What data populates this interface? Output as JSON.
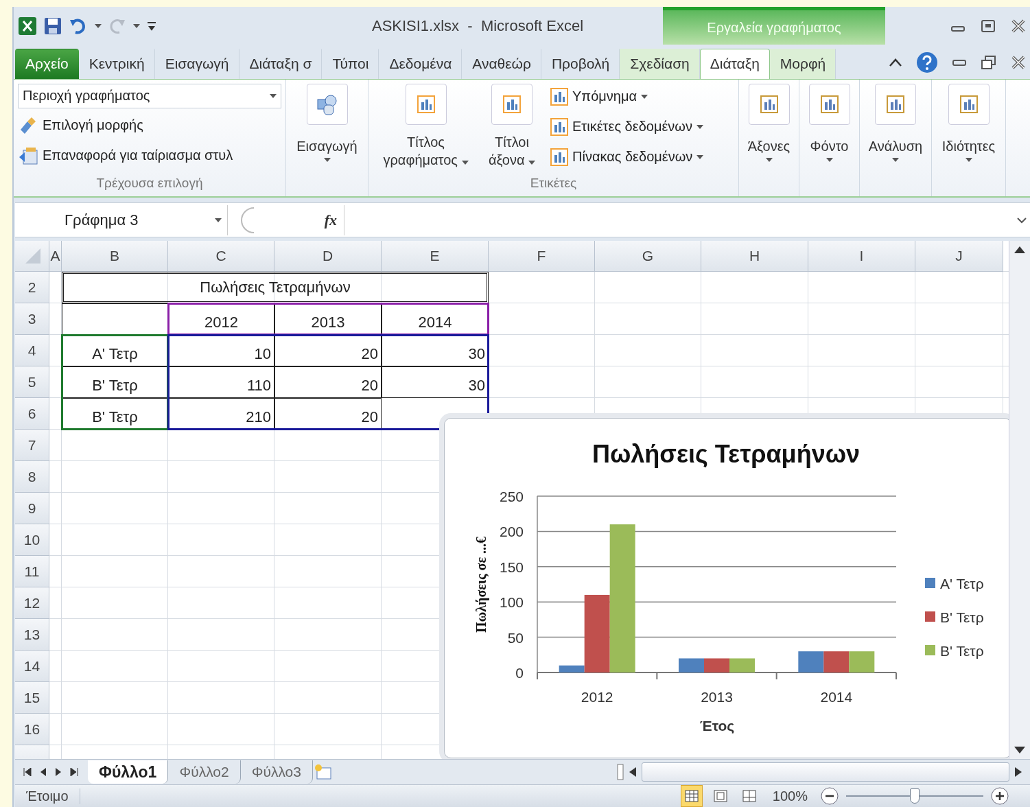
{
  "window": {
    "title": "ASKISI1.xlsx  -  Microsoft Excel",
    "context_title": "Εργαλεία γραφήματος"
  },
  "ribbon_tabs": [
    {
      "label": "Αρχείο",
      "kind": "file",
      "selected": false
    },
    {
      "label": "Κεντρική",
      "kind": "tab",
      "selected": false
    },
    {
      "label": "Εισαγωγή",
      "kind": "tab",
      "selected": false
    },
    {
      "label": "Διάταξη σ",
      "kind": "tab",
      "selected": false
    },
    {
      "label": "Τύποι",
      "kind": "tab",
      "selected": false
    },
    {
      "label": "Δεδομένα",
      "kind": "tab",
      "selected": false
    },
    {
      "label": "Αναθεώρ",
      "kind": "tab",
      "selected": false
    },
    {
      "label": "Προβολή",
      "kind": "tab",
      "selected": false
    },
    {
      "label": "Σχεδίαση",
      "kind": "context",
      "selected": false
    },
    {
      "label": "Διάταξη",
      "kind": "context",
      "selected": true
    },
    {
      "label": "Μορφή",
      "kind": "context",
      "selected": false
    }
  ],
  "ribbon": {
    "current_selection": {
      "dropdown": "Περιοχή γραφήματος",
      "buttons": [
        "Επιλογή μορφής",
        "Επαναφορά για ταίριασμα στυλ"
      ],
      "label": "Τρέχουσα επιλογή"
    },
    "insert": {
      "button": "Εισαγωγή"
    },
    "labels": {
      "large_buttons": [
        "Τίτλος γραφήματος",
        "Τίτλοι άξονα"
      ],
      "small_buttons": [
        "Υπόμνημα",
        "Ετικέτες δεδομένων",
        "Πίνακας δεδομένων"
      ],
      "label": "Ετικέτες"
    },
    "tool_buttons": [
      "Άξονες",
      "Φόντο",
      "Ανάλυση",
      "Ιδιότητες"
    ]
  },
  "formula_bar": {
    "name_box": "Γράφημα 3",
    "fx_label": "fx"
  },
  "sheet": {
    "columns": [
      "A",
      "B",
      "C",
      "D",
      "E",
      "F",
      "G",
      "H",
      "I",
      "J"
    ],
    "row_numbers": [
      "2",
      "3",
      "4",
      "5",
      "6",
      "7",
      "8",
      "9",
      "10",
      "11",
      "12",
      "13",
      "14",
      "15",
      "16"
    ],
    "table": {
      "title": "Πωλήσεις Τετραμήνων",
      "years": [
        "2012",
        "2013",
        "2014"
      ],
      "rows": [
        {
          "label": "Α' Τετρ",
          "values": [
            "10",
            "20",
            "30"
          ]
        },
        {
          "label": "Β' Τετρ",
          "values": [
            "110",
            "20",
            "30"
          ]
        },
        {
          "label": "Β' Τετρ",
          "values": [
            "210",
            "20"
          ]
        }
      ]
    }
  },
  "chart": {
    "chart_data": {
      "type": "bar",
      "title": "Πωλήσεις Τετραμήνων",
      "xlabel": "Έτος",
      "ylabel": "Πωλήσεις σε ...€",
      "categories": [
        "2012",
        "2013",
        "2014"
      ],
      "series": [
        {
          "name": "Α' Τετρ",
          "color": "#4f81bd",
          "values": [
            10,
            20,
            30
          ]
        },
        {
          "name": "Β' Τετρ",
          "color": "#c0504d",
          "values": [
            110,
            20,
            30
          ]
        },
        {
          "name": "Β' Τετρ",
          "color": "#9bbb59",
          "values": [
            210,
            20,
            30
          ]
        }
      ],
      "ylim": [
        0,
        250
      ],
      "yticks": [
        0,
        50,
        100,
        150,
        200,
        250
      ],
      "grid": true,
      "legend": true
    }
  },
  "sheet_tabs": [
    {
      "label": "Φύλλο1",
      "selected": true
    },
    {
      "label": "Φύλλο2",
      "selected": false
    },
    {
      "label": "Φύλλο3",
      "selected": false
    }
  ],
  "status_bar": {
    "status": "Έτοιμο",
    "views": [
      {
        "kind": "normal",
        "selected": true
      },
      {
        "kind": "page_layout",
        "selected": false
      },
      {
        "kind": "page_break",
        "selected": false
      }
    ],
    "zoom": "100%",
    "zoom_slider": {
      "level": 0.5
    }
  }
}
